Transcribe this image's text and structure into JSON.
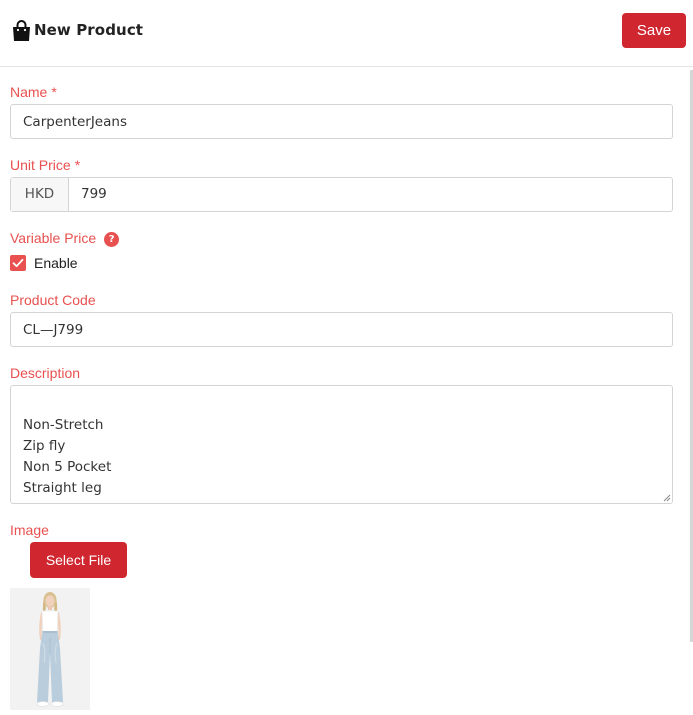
{
  "header": {
    "icon": "shopping-bag-icon",
    "title": "New Product",
    "save_label": "Save"
  },
  "form": {
    "name": {
      "label": "Name",
      "required_mark": "*",
      "value": "CarpenterJeans"
    },
    "unit_price": {
      "label": "Unit Price",
      "required_mark": "*",
      "currency": "HKD",
      "value": "799"
    },
    "variable_price": {
      "label": "Variable Price",
      "help_icon": "question-circle-icon",
      "help_glyph": "?",
      "checkbox_label": "Enable",
      "checked": true
    },
    "product_code": {
      "label": "Product Code",
      "value": "CL—J799"
    },
    "description": {
      "label": "Description",
      "value": "Non-Stretch\nZip fly\nNon 5 Pocket\nStraight leg"
    },
    "image": {
      "label": "Image",
      "select_file_label": "Select File"
    }
  },
  "colors": {
    "accent": "#d0262f",
    "label": "#e8514f",
    "border": "#d4d4d4"
  }
}
